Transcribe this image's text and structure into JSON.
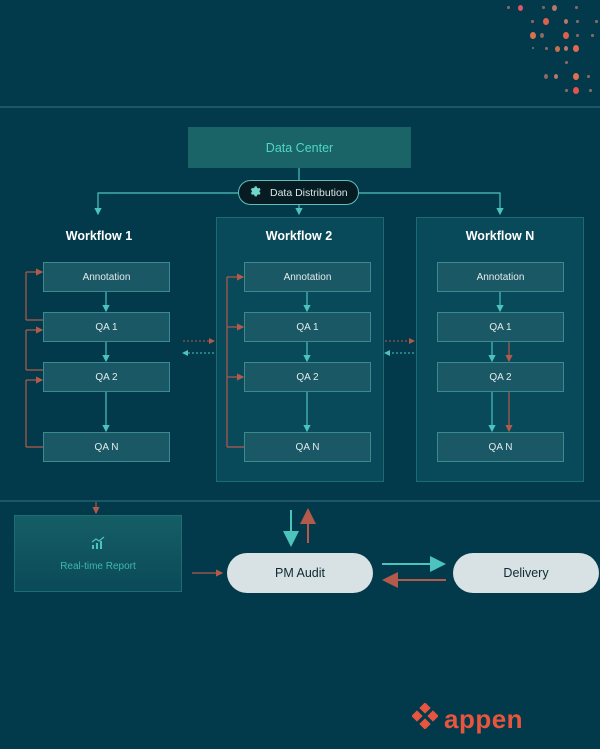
{
  "header": {
    "data_center_label": "Data Center",
    "distribution_label": "Data Distribution",
    "distribution_icon": "gear-icon"
  },
  "workflows": [
    {
      "title": "Workflow 1",
      "steps": [
        "Annotation",
        "QA 1",
        "QA 2",
        "QA N"
      ]
    },
    {
      "title": "Workflow 2",
      "steps": [
        "Annotation",
        "QA 1",
        "QA 2",
        "QA N"
      ]
    },
    {
      "title": "Workflow N",
      "steps": [
        "Annotation",
        "QA 1",
        "QA 2",
        "QA N"
      ]
    }
  ],
  "bottom": {
    "report_label": "Real-time Report",
    "report_icon": "chart-icon",
    "pm_audit_label": "PM Audit",
    "delivery_label": "Delivery"
  },
  "brand": {
    "name": "appen",
    "accent_color": "#e8553e",
    "flow_color": "#4cc3bd",
    "feedback_color": "#b45a4a"
  }
}
